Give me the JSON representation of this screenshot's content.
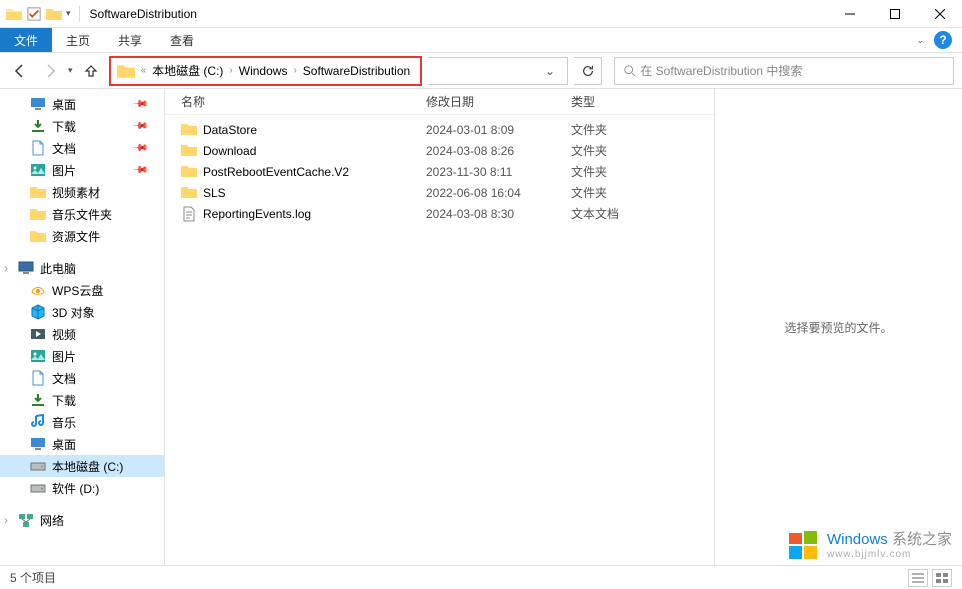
{
  "window": {
    "title": "SoftwareDistribution"
  },
  "ribbon": {
    "file": "文件",
    "tabs": [
      "主页",
      "共享",
      "查看"
    ]
  },
  "breadcrumb": {
    "segments": [
      "本地磁盘 (C:)",
      "Windows",
      "SoftwareDistribution"
    ]
  },
  "search": {
    "placeholder": "在 SoftwareDistribution 中搜索"
  },
  "sidebar": {
    "quick": [
      {
        "label": "桌面",
        "icon": "desktop",
        "pinned": true
      },
      {
        "label": "下载",
        "icon": "downloads",
        "pinned": true
      },
      {
        "label": "文档",
        "icon": "documents",
        "pinned": true
      },
      {
        "label": "图片",
        "icon": "pictures",
        "pinned": true
      },
      {
        "label": "视频素材",
        "icon": "folder"
      },
      {
        "label": "音乐文件夹",
        "icon": "folder"
      },
      {
        "label": "资源文件",
        "icon": "folder"
      }
    ],
    "this_pc_label": "此电脑",
    "this_pc": [
      {
        "label": "WPS云盘",
        "icon": "wps"
      },
      {
        "label": "3D 对象",
        "icon": "3d"
      },
      {
        "label": "视频",
        "icon": "videos"
      },
      {
        "label": "图片",
        "icon": "pictures"
      },
      {
        "label": "文档",
        "icon": "documents"
      },
      {
        "label": "下载",
        "icon": "downloads"
      },
      {
        "label": "音乐",
        "icon": "music"
      },
      {
        "label": "桌面",
        "icon": "desktop"
      },
      {
        "label": "本地磁盘 (C:)",
        "icon": "drive",
        "selected": true
      },
      {
        "label": "软件 (D:)",
        "icon": "drive"
      }
    ],
    "network_label": "网络"
  },
  "columns": {
    "name": "名称",
    "date": "修改日期",
    "type": "类型"
  },
  "files": [
    {
      "name": "DataStore",
      "date": "2024-03-01 8:09",
      "type": "文件夹",
      "icon": "folder"
    },
    {
      "name": "Download",
      "date": "2024-03-08 8:26",
      "type": "文件夹",
      "icon": "folder"
    },
    {
      "name": "PostRebootEventCache.V2",
      "date": "2023-11-30 8:11",
      "type": "文件夹",
      "icon": "folder"
    },
    {
      "name": "SLS",
      "date": "2022-06-08 16:04",
      "type": "文件夹",
      "icon": "folder"
    },
    {
      "name": "ReportingEvents.log",
      "date": "2024-03-08 8:30",
      "type": "文本文档",
      "icon": "textfile"
    }
  ],
  "preview": {
    "message": "选择要预览的文件。"
  },
  "status": {
    "count": "5 个项目"
  },
  "watermark": {
    "brand1": "Windows",
    "brand2": "系统之家",
    "url": "www.bjjmlv.com"
  }
}
